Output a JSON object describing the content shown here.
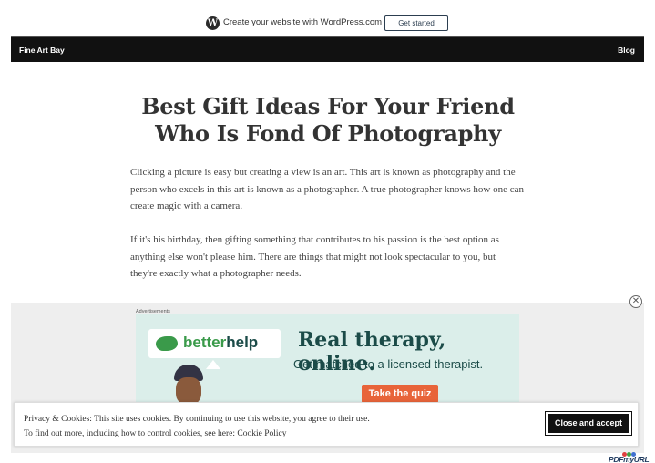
{
  "wp_bar": {
    "text": "Create your website with WordPress.com",
    "button": "Get started",
    "logo_letter": "W"
  },
  "header": {
    "site_title": "Fine Art Bay",
    "nav": [
      "Blog"
    ]
  },
  "article": {
    "title": "Best Gift Ideas For Your Friend Who Is Fond Of Photography",
    "paragraphs": [
      "Clicking a picture is easy but creating a view is an art. This art is known as photography and the person who excels in this art is known as a photographer. A true photographer knows how one can create magic with a camera.",
      "If it's his birthday, then gifting something that contributes to his passion is the best option as anything else won't please him. There are things that might not look spectacular to you, but they're exactly what a photographer needs."
    ]
  },
  "ad": {
    "label": "Advertisements",
    "close_glyph": "✕",
    "brand_prefix": "better",
    "brand_suffix": "help",
    "headline": "Real therapy, online.",
    "subline": "Get matched to a licensed therapist.",
    "cta": "Take the quiz",
    "background_color": "#dbeeea",
    "brand_color": "#3a9a4a",
    "cta_color": "#e8643a"
  },
  "cookie": {
    "line1": "Privacy & Cookies: This site uses cookies. By continuing to use this website, you agree to their use.",
    "line2_prefix": "To find out more, including how to control cookies, see here: ",
    "policy_link": "Cookie Policy",
    "accept_button": "Close and accept"
  },
  "footer_logo": {
    "text": "PDFmyURL",
    "icon": "pdfmyurl-logo-icon"
  }
}
